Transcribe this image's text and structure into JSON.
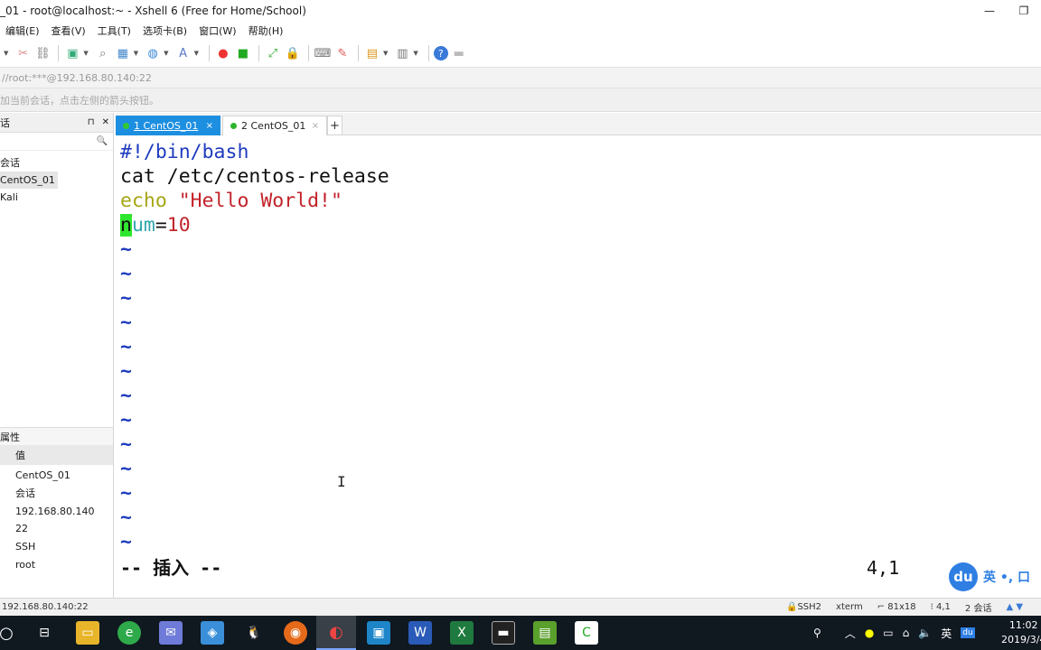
{
  "window": {
    "title": "_01 - root@localhost:~ - Xshell 6 (Free for Home/School)",
    "controls": {
      "minimize": "—",
      "maximize": "❐"
    }
  },
  "menu": [
    "编辑(E)",
    "查看(V)",
    "工具(T)",
    "选项卡(B)",
    "窗口(W)",
    "帮助(H)"
  ],
  "address": "//root:***@192.168.80.140:22",
  "hint": "加当前会话，点击左侧的箭头按钮。",
  "left_panel": {
    "title": "话",
    "pin": "⊓",
    "close": "✕",
    "search_icon": "🔍",
    "tree": [
      {
        "label": "会话",
        "selected": false
      },
      {
        "label": "CentOS_01",
        "selected": true
      },
      {
        "label": "Kali",
        "selected": false
      }
    ],
    "props_title": "属性",
    "props_column": "值",
    "props_values": [
      "CentOS_01",
      "会话",
      "192.168.80.140",
      "22",
      "SSH",
      "root"
    ]
  },
  "tabs": [
    {
      "label": "1 CentOS_01",
      "active": true,
      "close": "×"
    },
    {
      "label": "2 CentOS_01",
      "active": false,
      "close": "×"
    }
  ],
  "tab_add": "+",
  "terminal": {
    "line1": "#!/bin/bash",
    "line2": "cat /etc/centos-release",
    "line3_cmd": "echo",
    "line3_str": " \"Hello World!\"",
    "line4_cursor": "n",
    "line4_var": "um",
    "line4_eq": "=",
    "line4_val": "10",
    "tilde": "~",
    "tilde_count": 13,
    "mode": "-- 插入 --",
    "position": "4,1",
    "ibeam": "I"
  },
  "ime": {
    "logo": "du",
    "text": "英 •, 口"
  },
  "status": {
    "left": "192.168.80.140:22",
    "protocol": "SSH2",
    "term": "xterm",
    "size": "81x18",
    "cursor": "4,1",
    "sessions": "2 会话"
  },
  "taskbar": {
    "clock_time": "11:02",
    "clock_date": "2019/3/4",
    "ime_lang": "英"
  }
}
